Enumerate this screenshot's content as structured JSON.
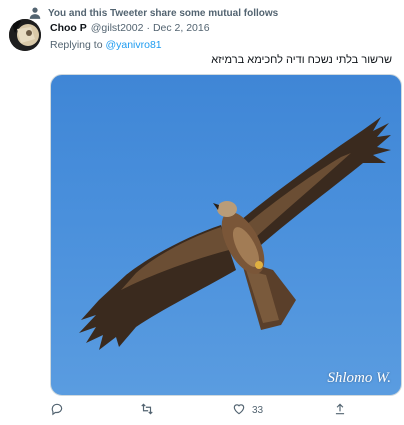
{
  "social_context": {
    "text": "You and this Tweeter share some mutual follows",
    "icon": "person-icon"
  },
  "author": {
    "name": "Choo P",
    "handle": "@gilst2002",
    "separator": "·",
    "date": "Dec 2, 2016"
  },
  "reply": {
    "prefix": "Replying to",
    "mention": "@yanivro81"
  },
  "tweet": {
    "text": "שרשור בלתי נשכח ודיה לחכימא ברמיזא"
  },
  "media": {
    "subject": "kite-bird-in-flight",
    "watermark": "Shlomo W."
  },
  "actions": {
    "reply": {
      "icon": "reply-icon"
    },
    "retweet": {
      "icon": "retweet-icon"
    },
    "like": {
      "icon": "heart-icon",
      "count": "33"
    },
    "share": {
      "icon": "share-icon"
    }
  },
  "colors": {
    "link": "#1d9bf0",
    "secondary_text": "#536471",
    "sky": "#4a90dc"
  }
}
